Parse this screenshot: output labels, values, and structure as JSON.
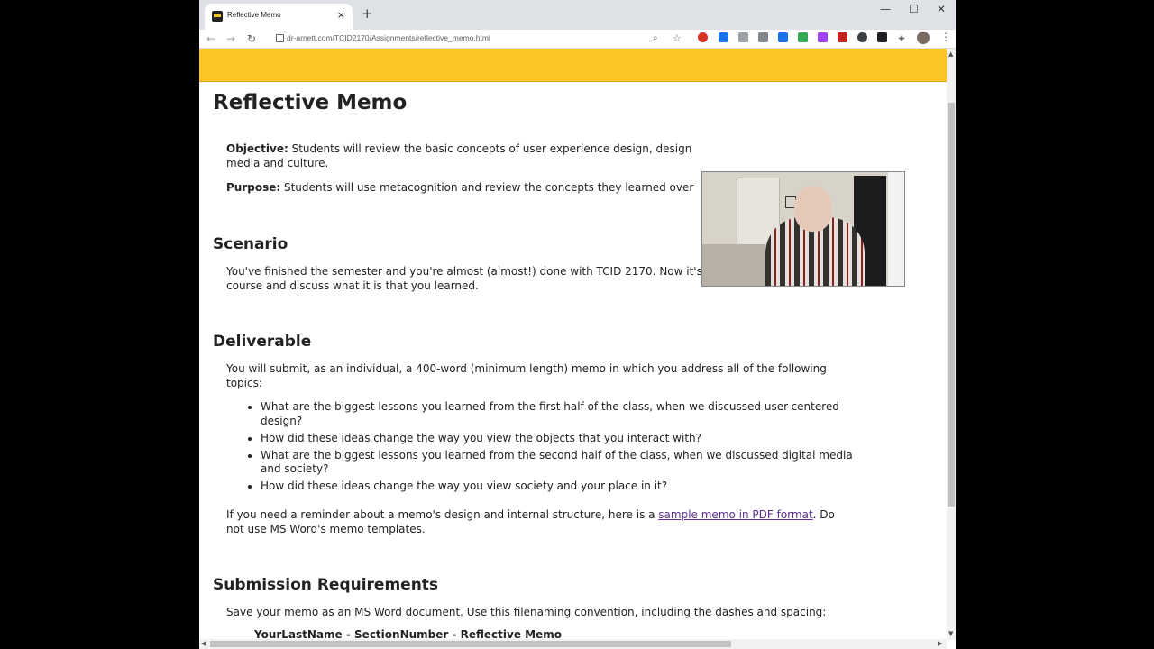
{
  "browser": {
    "tab_title": "Reflective Memo",
    "tab_close": "×",
    "new_tab": "+",
    "window_controls": [
      "—",
      "☐",
      "✕"
    ],
    "url": "dr-arnett.com/TCID2170/Assignments/reflective_memo.html"
  },
  "page": {
    "title": "Reflective Memo",
    "objective_label": "Objective:",
    "objective_text": " Students will review the basic concepts of user experience design, design",
    "objective_text_2": "media and culture.",
    "purpose_label": "Purpose:",
    "purpose_text": " Students will use metacognition and review the concepts they learned over",
    "scenario_heading": "Scenario",
    "scenario_text": "You've finished the semester and you're almost (almost!) done with TCID 2170. Now it's time to look back on the course and discuss what it is that you learned.",
    "deliverable_heading": "Deliverable",
    "deliverable_text": "You will submit, as an individual, a 400-word (minimum length) memo in which you address all of the following topics:",
    "topics": [
      "What are the biggest lessons you learned from the first half of the class, when we discussed user-centered design?",
      "How did these ideas change the way you view the objects that you interact with?",
      "What are the biggest lessons you learned from the second half of the class, when we discussed digital media and society?",
      "How did these ideas change the way you view society and your place in it?"
    ],
    "reminder_before": "If you need a reminder about a memo's design and internal structure, here is a ",
    "reminder_link": "sample memo in PDF format",
    "reminder_after": ". Do not use MS Word's memo templates.",
    "submission_heading": "Submission Requirements",
    "submission_text": "Save your memo as an MS Word document. Use this filenaming convention, including the dashes and spacing:",
    "filename_convention": "YourLastName - SectionNumber - Reflective Memo"
  },
  "colors": {
    "banner": "#fcc425",
    "link": "#5b2f91"
  }
}
